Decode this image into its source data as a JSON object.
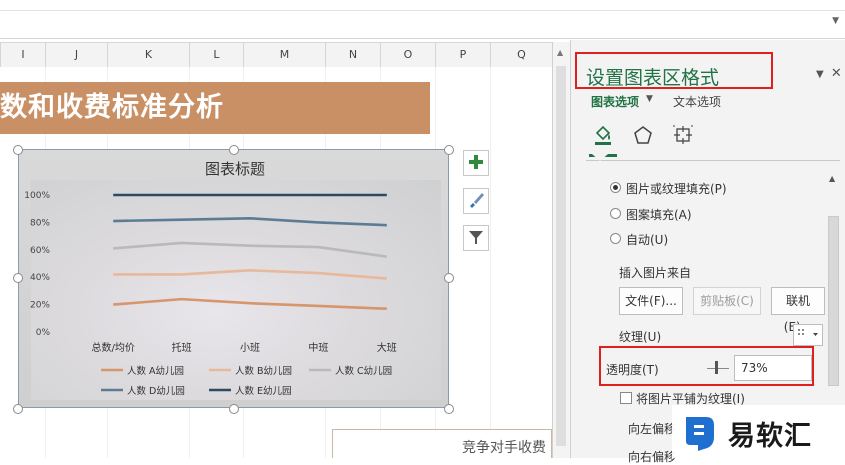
{
  "columns": [
    "I",
    "J",
    "K",
    "L",
    "M",
    "N",
    "O",
    "P",
    "Q"
  ],
  "sheet": {
    "banner_title": "数和收费标准分析",
    "bottom_text": "竞争对手收费"
  },
  "chart_data": {
    "type": "line",
    "title": "图表标题",
    "categories": [
      "总数/均价",
      "托班",
      "小班",
      "中班",
      "大班"
    ],
    "yticks": [
      "100%",
      "80%",
      "60%",
      "40%",
      "20%",
      "0%"
    ],
    "ylim": [
      0,
      1
    ],
    "grid": false,
    "legend_position": "bottom",
    "series": [
      {
        "name": "人数 A幼儿园",
        "color": "#d6956b",
        "values": [
          0.2,
          0.24,
          0.21,
          0.19,
          0.17
        ]
      },
      {
        "name": "人数 B幼儿园",
        "color": "#e8b89a",
        "values": [
          0.42,
          0.42,
          0.45,
          0.43,
          0.39
        ]
      },
      {
        "name": "人数 C幼儿园",
        "color": "#b9b9b9",
        "values": [
          0.61,
          0.65,
          0.63,
          0.62,
          0.55
        ]
      },
      {
        "name": "人数 D幼儿园",
        "color": "#5c7c95",
        "values": [
          0.81,
          0.82,
          0.83,
          0.8,
          0.78
        ]
      },
      {
        "name": "人数 E幼儿园",
        "color": "#2d4a61",
        "values": [
          1.0,
          1.0,
          1.0,
          1.0,
          1.0
        ]
      }
    ]
  },
  "chart_buttons": [
    {
      "name": "chart-elements-button",
      "icon": "plus-icon"
    },
    {
      "name": "chart-styles-button",
      "icon": "brush-icon"
    },
    {
      "name": "chart-filters-button",
      "icon": "filter-icon"
    }
  ],
  "pane": {
    "title": "设置图表区格式",
    "tab_chart": "图表选项",
    "tab_text": "文本选项",
    "fill_options": [
      {
        "label": "图片或纹理填充(P)",
        "checked": true
      },
      {
        "label": "图案填充(A)",
        "checked": false
      },
      {
        "label": "自动(U)",
        "checked": false
      }
    ],
    "insert_from": "插入图片来自",
    "buttons": {
      "file": "文件(F)...",
      "clipboard": "剪贴板(C)",
      "online": "联机(E)..."
    },
    "texture_label": "纹理(U)",
    "transparency_label": "透明度(T)",
    "transparency_value": "73%",
    "tile_label": "将图片平铺为纹理(I)",
    "offset_left": "向左偏移",
    "offset_right": "向右偏移"
  },
  "watermark": "易软汇",
  "colors": {
    "accent_green": "#217346",
    "highlight_red": "#e0201e",
    "banner": "#c99065"
  }
}
